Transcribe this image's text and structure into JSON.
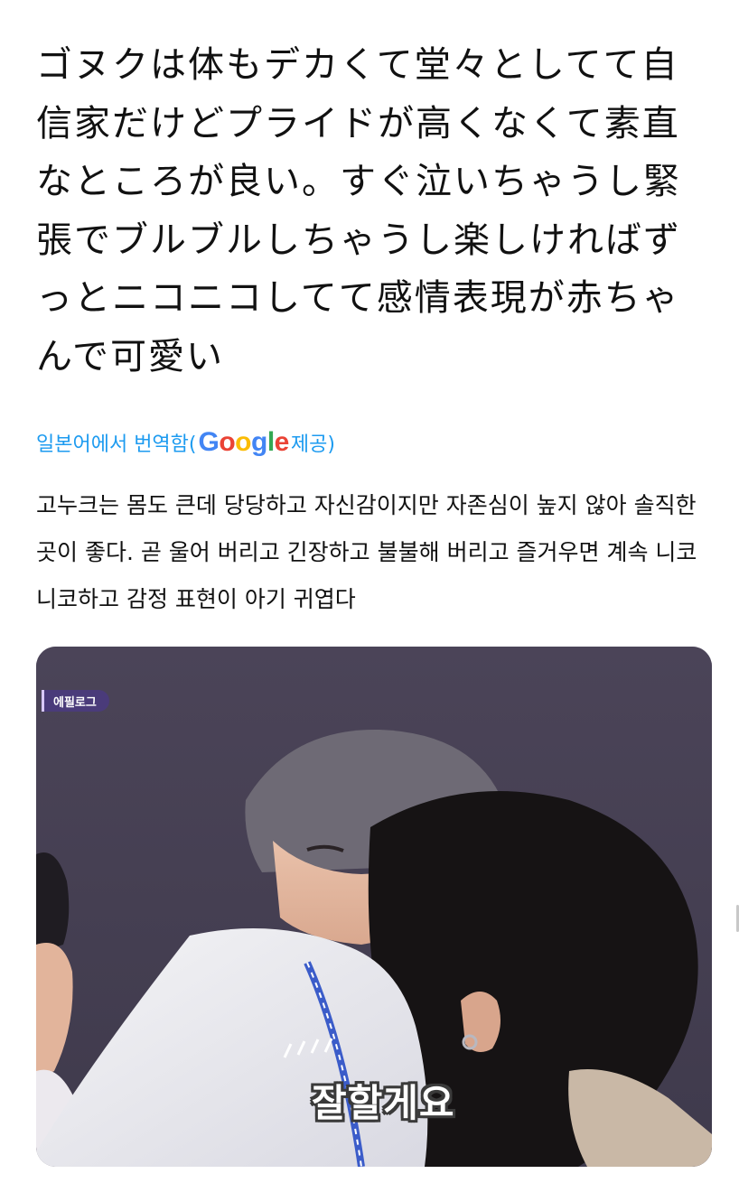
{
  "tweet": {
    "text": "ゴヌクは体もデカくて堂々としてて自信家だけどプライドが高くなくて素直なところが良い。すぐ泣いちゃうし緊張でブルブルしちゃうし楽しければずっとニコニコしてて感情表現が赤ちゃんで可愛い"
  },
  "translation": {
    "prefix": "일본어에서 번역함(",
    "google_logo": {
      "g1": "G",
      "o1": "o",
      "o2": "o",
      "g2": "g",
      "l": "l",
      "e": "e"
    },
    "suffix": " 제공)",
    "text": "고누크는 몸도 큰데 당당하고 자신감이지만 자존심이 높지 않아 솔직한 곳이 좋다. 곧 울어 버리고 긴장하고 불불해 버리고 즐거우면 계속 니코니코하고 감정 표현이 아기 귀엽다"
  },
  "media": {
    "badge": "에필로그",
    "caption": "잘할게요"
  },
  "colors": {
    "link_blue": "#1d9bf0",
    "google_blue": "#4285f4",
    "google_red": "#ea4335",
    "google_yellow": "#fbbc05",
    "google_green": "#34a853",
    "badge_purple": "#4a3b7a"
  }
}
